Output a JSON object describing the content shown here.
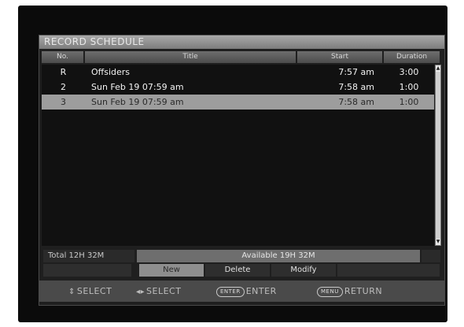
{
  "panel": {
    "title": "RECORD SCHEDULE"
  },
  "columns": {
    "no": "No.",
    "title": "Title",
    "start": "Start",
    "duration": "Duration"
  },
  "rows": [
    {
      "no": "R",
      "title": "Offsiders",
      "start": "7:57 am",
      "duration": "3:00",
      "selected": false
    },
    {
      "no": "2",
      "title": "Sun Feb 19 07:59 am",
      "start": "7:58 am",
      "duration": "1:00",
      "selected": false
    },
    {
      "no": "3",
      "title": "Sun Feb 19 07:59 am",
      "start": "7:58 am",
      "duration": "1:00",
      "selected": true
    }
  ],
  "status": {
    "total": "Total 12H 32M",
    "available": "Available 19H 32M"
  },
  "buttons": {
    "new": "New",
    "delete": "Delete",
    "modify": "Modify"
  },
  "footer": {
    "updown_icon": "up-down-arrows-icon",
    "select_vertical": "SELECT",
    "leftright_icon": "left-right-arrows-icon",
    "select_horizontal": "SELECT",
    "enter_key": "ENTER",
    "enter_label": "ENTER",
    "return_key": "MENU",
    "return_label": "RETURN"
  },
  "colors": {
    "selected_row": "#9d9d9d",
    "panel": "#1f1f1f",
    "footer": "#4a4a4a"
  }
}
